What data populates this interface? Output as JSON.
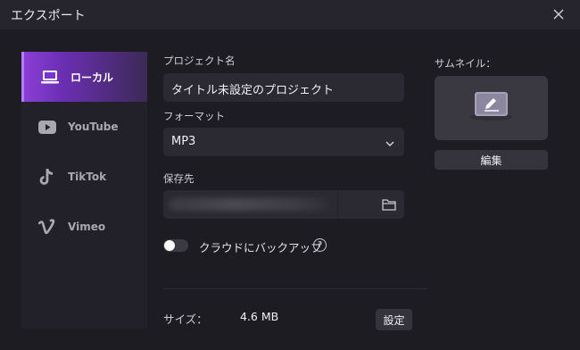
{
  "window": {
    "title": "エクスポート",
    "close_icon": "close-icon"
  },
  "sidebar": {
    "items": [
      {
        "label": "ローカル",
        "icon": "laptop-icon",
        "active": true
      },
      {
        "label": "YouTube",
        "icon": "youtube-icon",
        "active": false
      },
      {
        "label": "TikTok",
        "icon": "tiktok-icon",
        "active": false
      },
      {
        "label": "Vimeo",
        "icon": "vimeo-icon",
        "active": false
      }
    ]
  },
  "form": {
    "project_name_label": "プロジェクト名",
    "project_name_value": "タイトル未設定のプロジェクト",
    "format_label": "フォーマット",
    "format_value": "MP3",
    "save_to_label": "保存先",
    "cloud_backup_label": "クラウドにバックアップ",
    "cloud_backup_enabled": false,
    "help_glyph": "?"
  },
  "thumbnail": {
    "label": "サムネイル：",
    "edit_button": "編集"
  },
  "footer": {
    "size_label": "サイズ：",
    "size_value": "4.6 MB",
    "settings_button": "設定"
  },
  "colors": {
    "accent": "#8a3fd6",
    "background": "#1d1c23",
    "field": "#2b2a33"
  }
}
